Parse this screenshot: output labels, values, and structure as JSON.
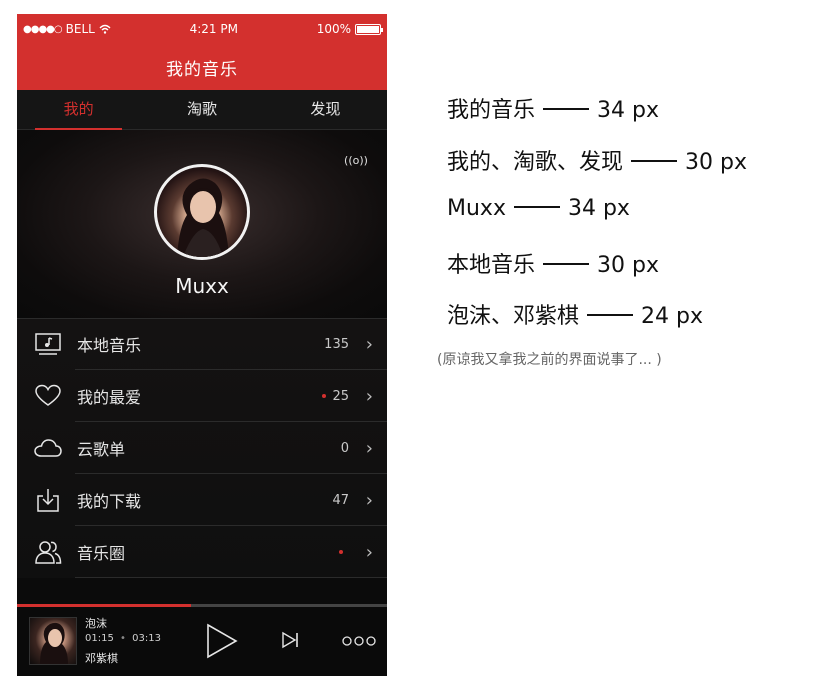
{
  "status_bar": {
    "carrier": "BELL",
    "time": "4:21 PM",
    "battery": "100%"
  },
  "nav": {
    "title": "我的音乐"
  },
  "tabs": [
    {
      "label": "我的",
      "active": true
    },
    {
      "label": "淘歌",
      "active": false
    },
    {
      "label": "发现",
      "active": false
    }
  ],
  "profile": {
    "username": "Muxx",
    "radio_icon": "((o))"
  },
  "list": [
    {
      "label": "本地音乐",
      "count": "135",
      "dot": false,
      "icon": "music-screen-icon"
    },
    {
      "label": "我的最爱",
      "count": "25",
      "dot": true,
      "icon": "heart-icon"
    },
    {
      "label": "云歌单",
      "count": "0",
      "dot": false,
      "icon": "cloud-icon"
    },
    {
      "label": "我的下载",
      "count": "47",
      "dot": false,
      "icon": "download-icon"
    },
    {
      "label": "音乐圈",
      "count": "",
      "dot": true,
      "icon": "people-icon"
    }
  ],
  "player": {
    "title": "泡沫",
    "current_time": "01:15",
    "total_time": "03:13",
    "artist": "邓紫棋",
    "progress": 0.47
  },
  "annotations": [
    {
      "text": "我的音乐",
      "size": "34 px"
    },
    {
      "text": "我的、淘歌、发现",
      "size": "30 px"
    },
    {
      "text": "Muxx",
      "size": "34 px"
    },
    {
      "text": "本地音乐",
      "size": "30 px"
    },
    {
      "text": "泡沫、邓紫棋",
      "size": "24 px"
    }
  ],
  "aside_note": "(原谅我又拿我之前的界面说事了... )",
  "colors": {
    "accent": "#d3302e",
    "background": "#0b0b0b"
  }
}
